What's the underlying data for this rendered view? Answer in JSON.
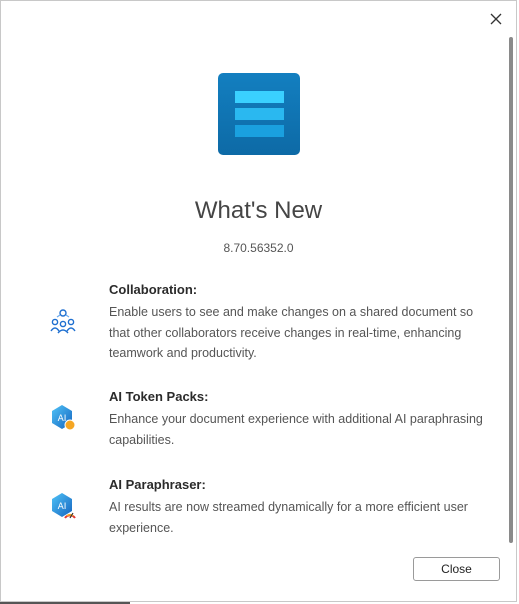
{
  "dialog": {
    "title": "What's New",
    "version": "8.70.56352.0",
    "close_button_label": "Close"
  },
  "features": [
    {
      "heading": "Collaboration:",
      "description": "Enable users to see and make changes on a shared document so that other collaborators receive changes in real-time, enhancing teamwork and productivity.",
      "icon": "collaboration-icon"
    },
    {
      "heading": "AI Token Packs:",
      "description": "Enhance your document experience with additional AI paraphrasing capabilities.",
      "icon": "ai-token-icon"
    },
    {
      "heading": "AI Paraphraser:",
      "description": "AI results are now streamed dynamically for a more efficient user experience.",
      "icon": "ai-paraphraser-icon"
    }
  ],
  "colors": {
    "logo": "#137fc0",
    "logo_bars": "#3ad0ff",
    "accent_blue": "#1e88e5",
    "accent_orange": "#f5a623"
  }
}
